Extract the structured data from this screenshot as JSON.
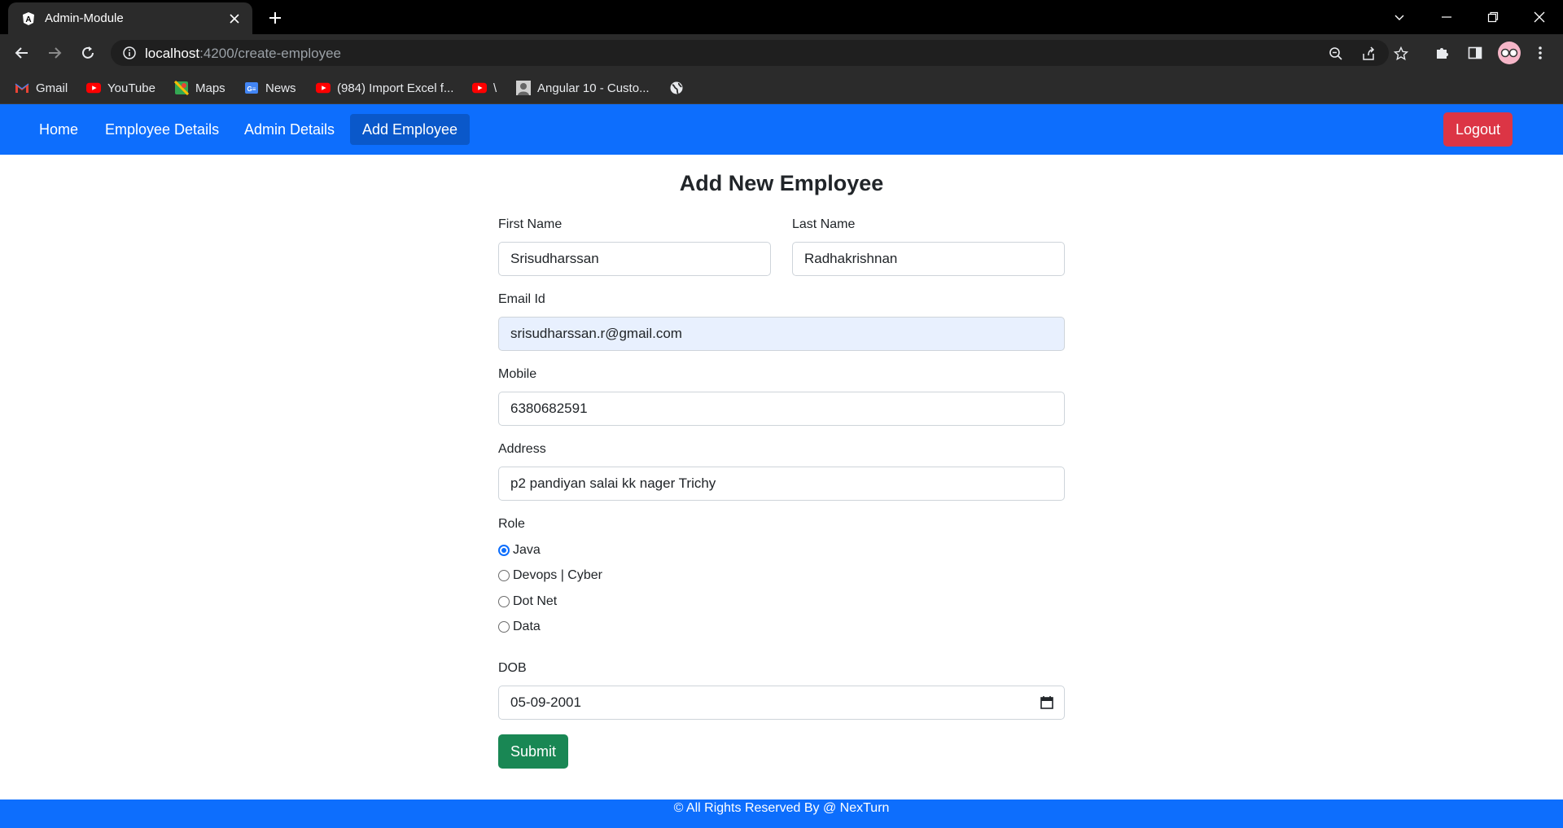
{
  "browser": {
    "tab_title": "Admin-Module",
    "url_host": "localhost",
    "url_rest": ":4200/create-employee",
    "bookmarks": [
      "Gmail",
      "YouTube",
      "Maps",
      "News",
      "(984) Import Excel f...",
      "\\",
      "Angular 10 - Custo..."
    ]
  },
  "nav": {
    "links": [
      "Home",
      "Employee Details",
      "Admin Details",
      "Add Employee"
    ],
    "active": "Add Employee",
    "logout_label": "Logout"
  },
  "form": {
    "title": "Add New Employee",
    "first_name": {
      "label": "First Name",
      "value": "Srisudharssan"
    },
    "last_name": {
      "label": "Last Name",
      "value": "Radhakrishnan"
    },
    "email": {
      "label": "Email Id",
      "value": "srisudharssan.r@gmail.com"
    },
    "mobile": {
      "label": "Mobile",
      "value": "6380682591"
    },
    "address": {
      "label": "Address",
      "value": "p2 pandiyan salai kk nager Trichy"
    },
    "role": {
      "label": "Role",
      "options": [
        "Java",
        "Devops | Cyber",
        "Dot Net",
        "Data"
      ],
      "selected": "Java"
    },
    "dob": {
      "label": "DOB",
      "value": "05-09-2001"
    },
    "submit_label": "Submit"
  },
  "footer": {
    "text": "© All Rights Reserved By @ NexTurn"
  },
  "colors": {
    "primary": "#0d6efd",
    "danger": "#dc3545",
    "success": "#198754",
    "autofill": "#e8f0fe"
  }
}
